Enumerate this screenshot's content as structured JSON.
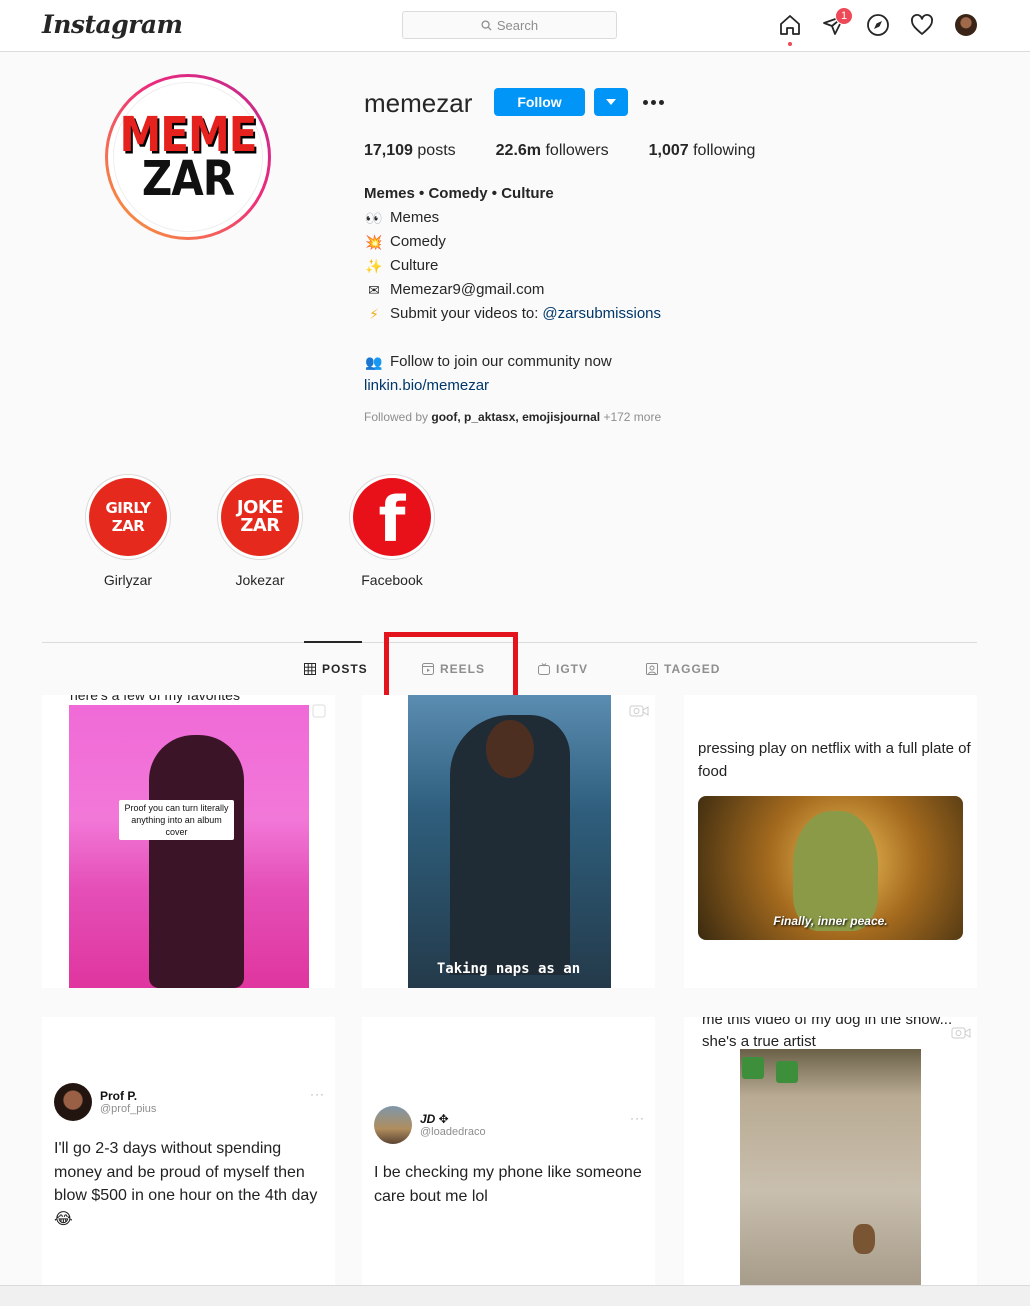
{
  "header": {
    "logo": "Instagram",
    "search_placeholder": "Search",
    "notification_count": "1"
  },
  "profile": {
    "avatar_text_top": "MEME",
    "avatar_text_bottom": "ZAR",
    "username": "memezar",
    "follow_label": "Follow",
    "stats": {
      "posts_count": "17,109",
      "posts_label": "posts",
      "followers_count": "22.6m",
      "followers_label": "followers",
      "following_count": "1,007",
      "following_label": "following"
    },
    "bio": {
      "name": "Memes • Comedy • Culture",
      "line1": "Memes",
      "line2": "Comedy",
      "line3": "Culture",
      "email": "Memezar9@gmail.com",
      "submit_text": "Submit your videos to:",
      "submit_mention": "@zarsubmissions",
      "community": "Follow to join our community now",
      "link": "linkin.bio/memezar"
    },
    "followed_by": {
      "prefix": "Followed by",
      "names": "goof, p_aktasx, emojisjournal",
      "more": "+172 more"
    }
  },
  "highlights": [
    {
      "label": "Girlyzar",
      "line1": "GIRLY",
      "line2": "ZAR"
    },
    {
      "label": "Jokezar",
      "line1": "JOKE",
      "line2": "ZAR"
    },
    {
      "label": "Facebook",
      "glyph": "f"
    }
  ],
  "tabs": {
    "posts": "POSTS",
    "reels": "REELS",
    "igtv": "IGTV",
    "tagged": "TAGGED"
  },
  "posts": {
    "p1": {
      "caption_top": "here's a few of my favorites",
      "overlay": "Proof you can turn literally anything into an album cover"
    },
    "p2": {
      "caption": "Taking naps as an"
    },
    "p3": {
      "text": "pressing play on netflix with a full plate of food",
      "subtitle": "Finally, inner peace."
    },
    "p4": {
      "name": "Prof P.",
      "handle": "@prof_pius",
      "body": "I'll go 2-3 days without spending money and be proud of myself then blow $500 in one hour on the 4th day 😂"
    },
    "p5": {
      "name": "JD ✥",
      "handle": "@loadedraco",
      "body": "I be checking my phone like someone care bout me lol"
    },
    "p6": {
      "text": "me this video of my dog in the snow... she's a true artist"
    }
  },
  "colors": {
    "accent": "#0095f6",
    "highlight_box": "#e3141e",
    "brand_red": "#e52a1d"
  }
}
